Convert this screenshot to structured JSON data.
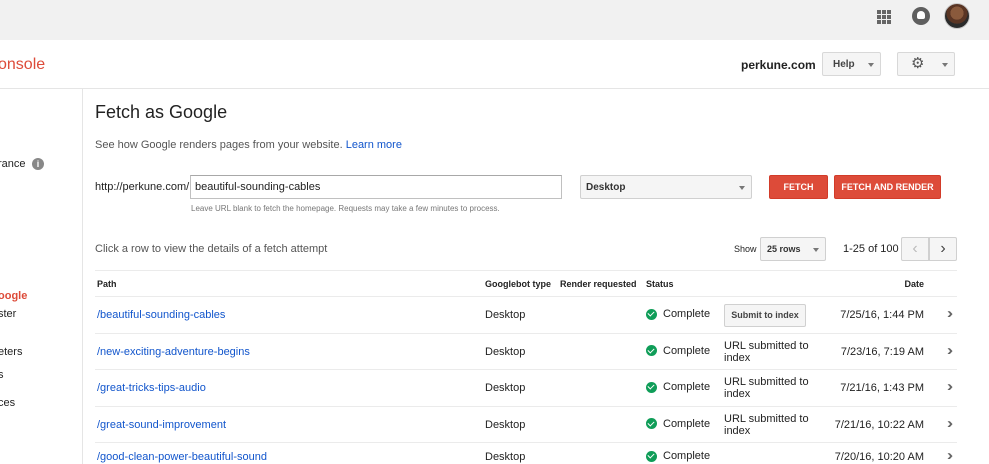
{
  "app": {
    "brand": "onsole",
    "site": "perkune.com",
    "help_label": "Help"
  },
  "sidebar": {
    "items": [
      {
        "label": "rance"
      },
      {
        "label": "oogle"
      },
      {
        "label": "ster"
      },
      {
        "label": "eters"
      },
      {
        "label": "s"
      },
      {
        "label": "ces"
      }
    ]
  },
  "page": {
    "title": "Fetch as Google",
    "intro": "See how Google renders pages from your website.",
    "learn_more": "Learn more",
    "url_prefix": "http://perkune.com/",
    "url_value": "beautiful-sounding-cables",
    "url_hint": "Leave URL blank to fetch the homepage. Requests may take a few minutes to process.",
    "device": "Desktop",
    "fetch_label": "FETCH",
    "fetch_render_label": "FETCH AND RENDER",
    "row_hint": "Click a row to view the details of a fetch attempt",
    "show_label": "Show",
    "rows_option": "25 rows",
    "range": "1-25 of 100"
  },
  "table": {
    "headers": {
      "path": "Path",
      "type": "Googlebot type",
      "render": "Render requested",
      "status": "Status",
      "date": "Date"
    },
    "rows": [
      {
        "path": "/beautiful-sounding-cables",
        "type": "Desktop",
        "status": "Complete",
        "action": "Submit to index",
        "date": "7/25/16, 1:44 PM"
      },
      {
        "path": "/new-exciting-adventure-begins",
        "type": "Desktop",
        "status": "Complete",
        "action": "URL submitted to index",
        "date": "7/23/16, 7:19 AM"
      },
      {
        "path": "/great-tricks-tips-audio",
        "type": "Desktop",
        "status": "Complete",
        "action": "URL submitted to index",
        "date": "7/21/16, 1:43 PM"
      },
      {
        "path": "/great-sound-improvement",
        "type": "Desktop",
        "status": "Complete",
        "action": "URL submitted to index",
        "date": "7/21/16, 10:22 AM"
      },
      {
        "path": "/good-clean-power-beautiful-sound",
        "type": "Desktop",
        "status": "Complete",
        "action": "",
        "date": "7/20/16, 10:20 AM"
      }
    ]
  },
  "icons": {
    "apps": "apps-grid-icon",
    "notifications": "notifications-icon",
    "settings": "gear-icon",
    "status_complete": "check-circle-icon",
    "row_open": "double-chevron-right-icon",
    "info": "info-icon"
  },
  "colors": {
    "brand_red": "#dd4b39",
    "link_blue": "#1155cc",
    "success_green": "#0f9d58"
  }
}
